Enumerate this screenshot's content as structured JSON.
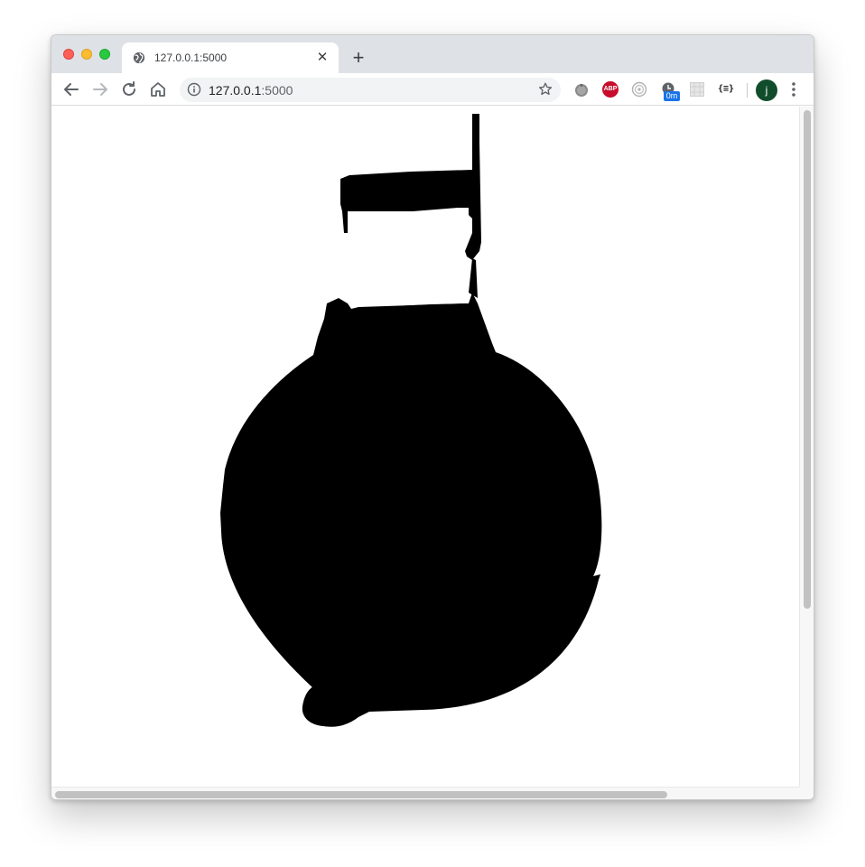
{
  "browser": {
    "tab": {
      "title": "127.0.0.1:5000"
    },
    "address": {
      "host": "127.0.0.1",
      "port": ":5000"
    },
    "extensions": {
      "adblock_label": "ABP",
      "timer_badge": "0m",
      "json_viewer_label": "{≡}"
    },
    "profile": {
      "initial": "j"
    }
  },
  "page": {
    "content": "black blob silhouette drawing on white background"
  }
}
